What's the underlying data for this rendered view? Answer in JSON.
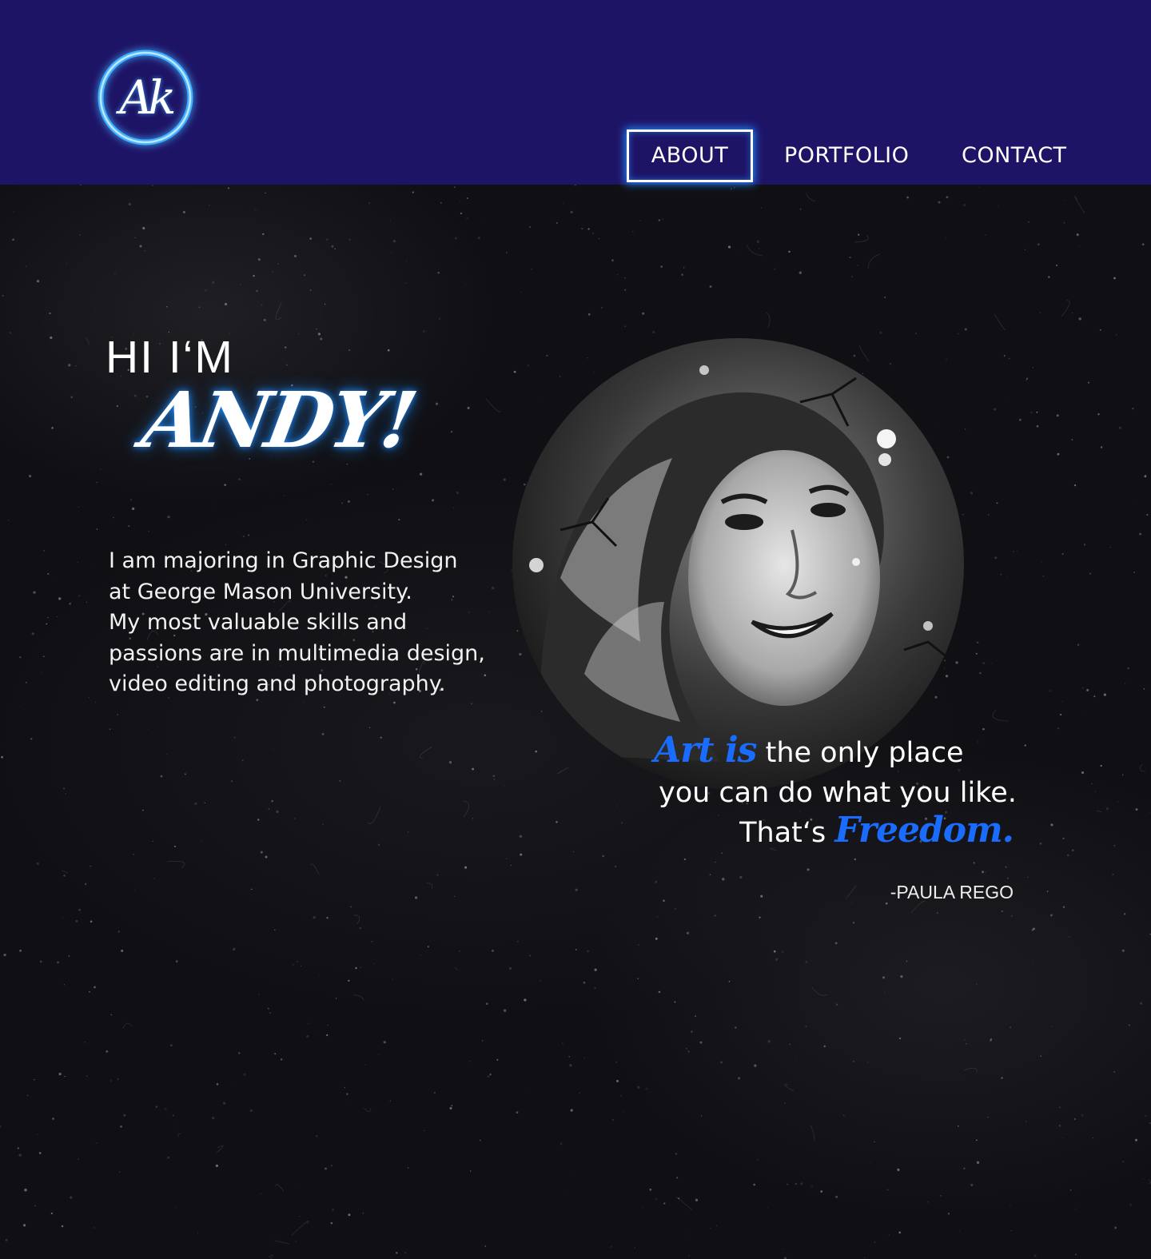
{
  "header": {
    "logo_text": "Ak",
    "nav": {
      "about": "ABOUT",
      "portfolio": "PORTFOLIO",
      "contact": "CONTACT",
      "active": "ABOUT"
    }
  },
  "hero": {
    "greeting": "HI I‘M",
    "name": "ANDY!",
    "bio": [
      "I am majoring in Graphic Design",
      "at George Mason University.",
      "My most valuable skills and",
      "passions are in multimedia design,",
      "video editing and photography."
    ],
    "quote": {
      "accent_1": "Art is",
      "line_1_rest": "the only place",
      "line_2": "you can do what you like.",
      "line_3_start": "That‘s",
      "accent_2": "Freedom.",
      "author": "-PAULA REGO"
    }
  },
  "colors": {
    "header_bg": "#1e1466",
    "page_bg": "#101014",
    "accent_blue": "#1a6cff",
    "glow_blue": "#238cff",
    "text": "#ffffff"
  },
  "icons": {
    "logo": "ak-monogram-logo-icon",
    "portrait": "profile-photo"
  }
}
